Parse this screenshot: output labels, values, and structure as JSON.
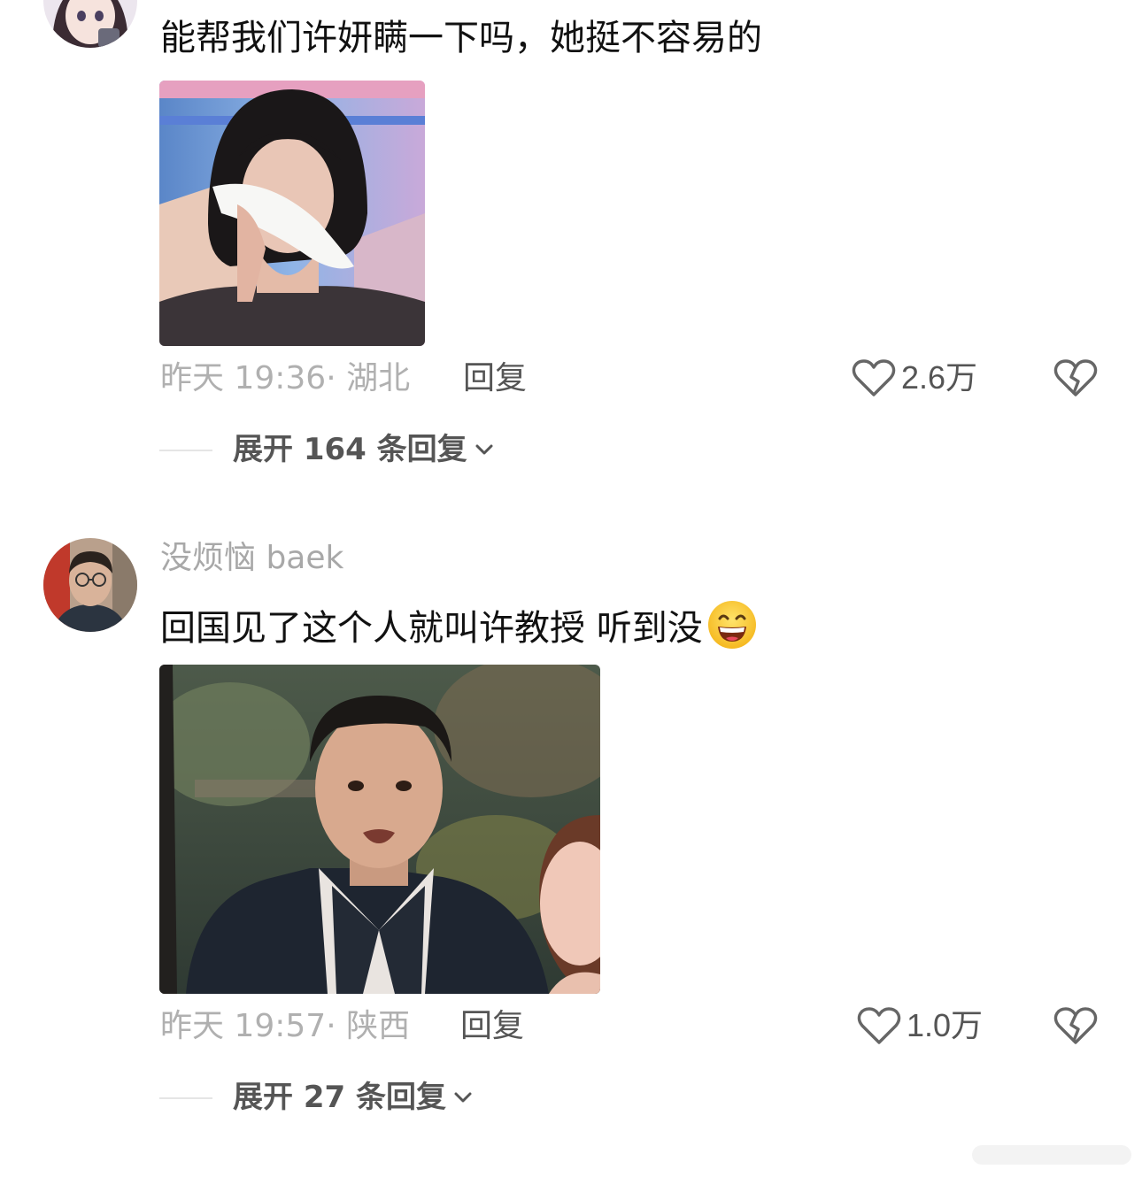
{
  "comments": [
    {
      "username": "",
      "text": "能帮我们许妍瞒一下吗，她挺不容易的",
      "time": "昨天 19:36",
      "location": "湖北",
      "reply_label": "回复",
      "likes": "2.6万",
      "expand_label": "展开 164 条回复",
      "avatar": "anime-girl-avatar",
      "image": "woman-crying-tissue-still"
    },
    {
      "username": "没烦恼 baek",
      "text": "回国见了这个人就叫许教授 听到没",
      "emoji": "grinning-sweat-face",
      "time": "昨天 19:57",
      "location": "陕西",
      "reply_label": "回复",
      "likes": "1.0万",
      "expand_label": "展开 27 条回复",
      "avatar": "man-with-glasses-avatar",
      "image": "man-in-suit-drama-still"
    }
  ],
  "meta_separator": "· ",
  "icons": {
    "like": "heart-outline-icon",
    "dislike": "broken-heart-icon",
    "expand": "chevron-down-icon"
  },
  "colors": {
    "text": "#111111",
    "meta": "#b0b0b0",
    "action": "#555555"
  }
}
